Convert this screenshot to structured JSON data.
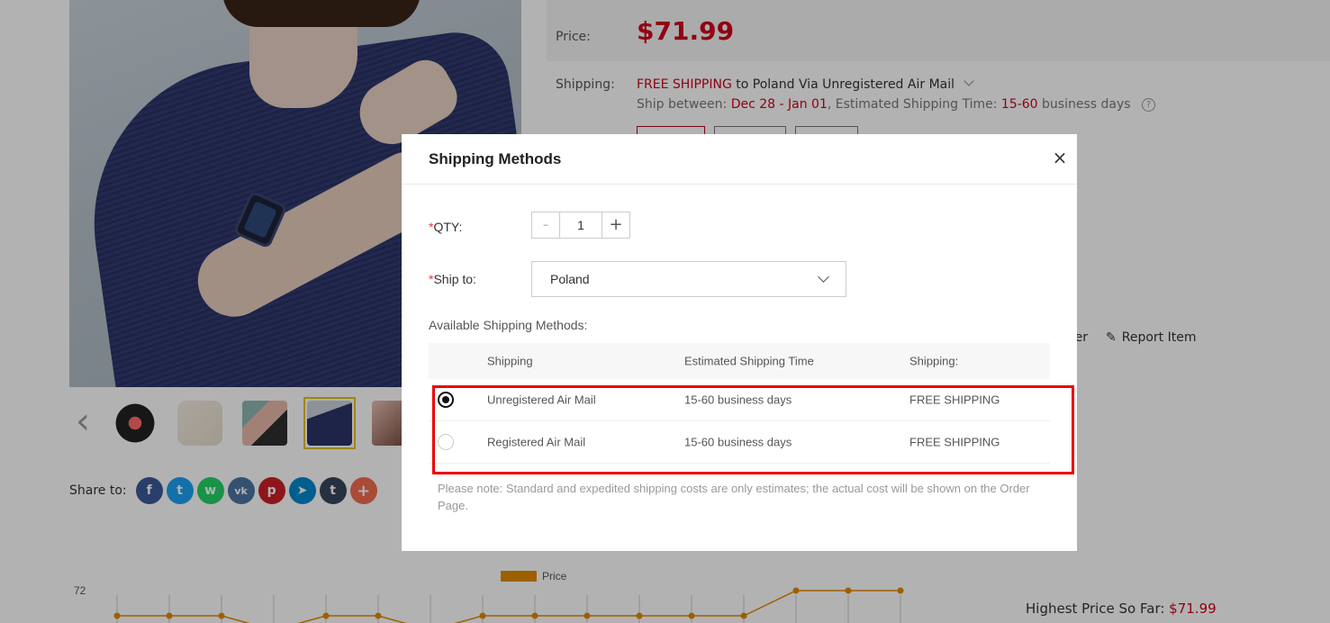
{
  "product": {
    "price_label": "Price:",
    "price": "$71.99",
    "shipping_label": "Shipping:",
    "shipping_free": "FREE SHIPPING",
    "shipping_rest": " to Poland Via Unregistered Air Mail",
    "ship_between_label": "Ship between: ",
    "ship_between_dates": "Dec 28 - Jan 01",
    "est_time_label": ", Estimated Shipping Time: ",
    "est_time_value": "15-60",
    "est_time_unit": " business days",
    "help_icon": "?",
    "links": [
      {
        "label": "mer",
        "icon": "disclaimer-icon"
      },
      {
        "label": "Report Item",
        "icon": "pencil-icon"
      }
    ]
  },
  "gallery": {
    "prev_arrow": "‹",
    "thumbnails": [
      {
        "name": "watch-front"
      },
      {
        "name": "watch-beige"
      },
      {
        "name": "watch-colors"
      },
      {
        "name": "watch-model-blue",
        "active": true
      },
      {
        "name": "watch-model-hand"
      }
    ]
  },
  "share": {
    "label": "Share to:",
    "buttons": [
      {
        "name": "facebook",
        "glyph": "f",
        "color": "#3b5998"
      },
      {
        "name": "twitter",
        "glyph": "t",
        "color": "#1da1f2"
      },
      {
        "name": "whatsapp",
        "glyph": "w",
        "color": "#25d366"
      },
      {
        "name": "vk",
        "glyph": "vk",
        "color": "#4c75a3"
      },
      {
        "name": "pinterest",
        "glyph": "p",
        "color": "#cb2027"
      },
      {
        "name": "telegram",
        "glyph": "➤",
        "color": "#0088cc"
      },
      {
        "name": "tumblr",
        "glyph": "t",
        "color": "#35465c"
      },
      {
        "name": "more",
        "glyph": "+",
        "color": "#f26c4f"
      }
    ]
  },
  "price_chart": {
    "legend": "Price",
    "y_tick": "72",
    "highest_label": "Highest Price So Far: ",
    "highest_value": "$71.99"
  },
  "chart_data": {
    "type": "line",
    "title": "",
    "legend": [
      "Price"
    ],
    "series": [
      {
        "name": "Price",
        "values": [
          71.5,
          71.5,
          71.5,
          71,
          71.5,
          71.5,
          71,
          71.5,
          71.5,
          71.5,
          71.5,
          71.5,
          71.5,
          71.99,
          71.99,
          71.99
        ]
      }
    ],
    "y_ticks": [
      "72"
    ],
    "color": "#e08a00"
  },
  "modal": {
    "title": "Shipping Methods",
    "close_icon": "×",
    "qty_label": "QTY:",
    "qty_required": "*",
    "qty_minus": "-",
    "qty_value": "1",
    "qty_plus": "+",
    "shipto_label": "Ship to:",
    "shipto_required": "*",
    "shipto_value": "Poland",
    "available_label": "Available Shipping Methods:",
    "columns": [
      "Shipping",
      "Estimated Shipping Time",
      "Shipping:"
    ],
    "rows": [
      {
        "method": "Unregistered Air Mail",
        "time": "15-60 business days",
        "cost": "FREE SHIPPING",
        "selected": true
      },
      {
        "method": "Registered Air Mail",
        "time": "15-60 business days",
        "cost": "FREE SHIPPING",
        "selected": false
      }
    ],
    "note": "Please note: Standard and expedited shipping costs are only estimates; the actual cost will be shown on the Order Page."
  }
}
